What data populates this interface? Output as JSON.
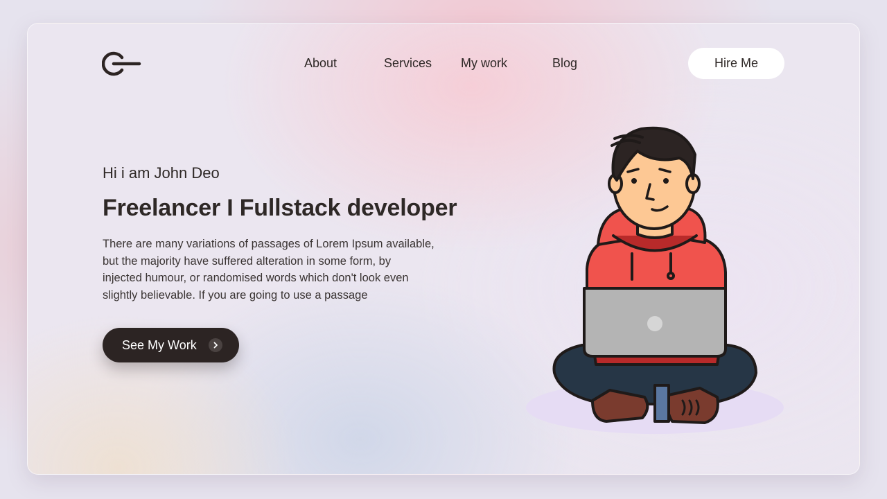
{
  "nav": {
    "items": [
      {
        "label": "About"
      },
      {
        "label": "Services"
      },
      {
        "label": "My work"
      },
      {
        "label": "Blog"
      }
    ],
    "hire_label": "Hire Me"
  },
  "hero": {
    "greeting": "Hi i am John Deo",
    "headline": "Freelancer I Fullstack developer",
    "description_lines": [
      "There are many variations of passages of Lorem Ipsum available,",
      "but the majority have suffered alteration in some form, by",
      "injected humour, or randomised words which don't look even",
      "slightly believable. If you are going to use a passage"
    ],
    "cta_label": "See My Work",
    "cta_icon": "chevron-right-icon"
  },
  "colors": {
    "dark": "#2c2423",
    "hoodie": "#f0534d",
    "laptop": "#b4b4b4",
    "skin": "#fdc894",
    "pants": "#263646"
  },
  "icons": {
    "logo": "power-logo-icon",
    "illustration": "developer-with-laptop-illustration"
  }
}
